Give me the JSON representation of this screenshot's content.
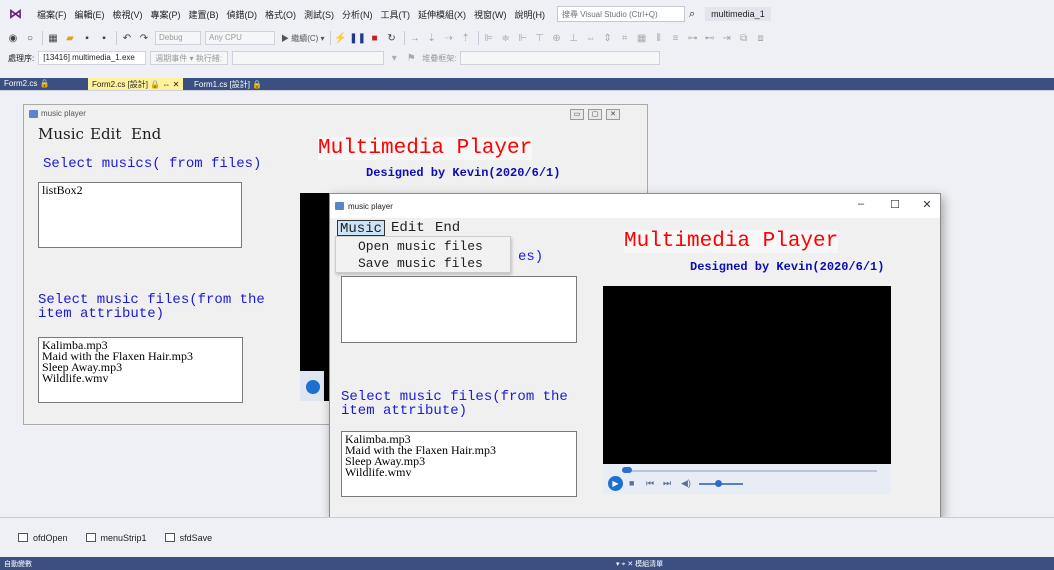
{
  "ide": {
    "menus": [
      "檔案(F)",
      "編輯(E)",
      "檢視(V)",
      "專案(P)",
      "建置(B)",
      "偵錯(D)",
      "格式(O)",
      "測試(S)",
      "分析(N)",
      "工具(T)",
      "延伸模組(X)",
      "視窗(W)",
      "說明(H)"
    ],
    "search_placeholder": "搜尋 Visual Studio (Ctrl+Q)",
    "project_name": "multimedia_1",
    "toolbar": {
      "config": "Debug",
      "platform": "Any CPU",
      "start_label": "▶ 繼續(C) ▾"
    },
    "process_label": "處理序:",
    "process_value": "[13416] multimedia_1.exe",
    "lifecycle_label": "週期事件 ▾ 執行緒:",
    "stack_label": "堆疊框架:",
    "tabs": [
      {
        "label": "Form2.cs 🔒"
      },
      {
        "label": "Form2.cs [設計] 🔒  ⇔  ✕"
      },
      {
        "label": "Form1.cs [設計] 🔒"
      }
    ],
    "tray": [
      {
        "label": "ofdOpen"
      },
      {
        "label": "menuStrip1"
      },
      {
        "label": "sfdSave"
      }
    ],
    "status_left": "自動變數",
    "status_right": "▾ ⌖ ✕   模組清單"
  },
  "design_form": {
    "title": "music player",
    "menu": [
      "Music",
      "Edit",
      "End"
    ],
    "title_label": "Multimedia Player",
    "subtitle": "Designed by Kevin(2020/6/1)",
    "select_label": "Select musics( from files)",
    "listbox2_text": "listBox2",
    "attr_label_1": "Select music files(from the",
    "attr_label_2": "item attribute)",
    "files": [
      "Kalimba.mp3",
      "Maid with the Flaxen Hair.mp3",
      "Sleep Away.mp3",
      "Wildlife.wmv"
    ]
  },
  "run_form": {
    "title": "music player",
    "caption_buttons": [
      "–",
      "☐",
      "✕"
    ],
    "menu": [
      "Music",
      "Edit",
      "End"
    ],
    "dropdown": [
      "Open music files",
      "Save music files"
    ],
    "hidden_label_tail": "es)",
    "title_label": "Multimedia Player",
    "subtitle": "Designed by Kevin(2020/6/1)",
    "attr_label_1": "Select music files(from the",
    "attr_label_2": "item attribute)",
    "files": [
      "Kalimba.mp3",
      "Maid with the Flaxen Hair.mp3",
      "Sleep Away.mp3",
      "Wildlife.wmv"
    ]
  },
  "colors": {
    "accent_tab": "#fff29d",
    "ide_blue": "#3b4f81",
    "title_red": "#ff0000",
    "label_blue": "#1a1adb"
  }
}
